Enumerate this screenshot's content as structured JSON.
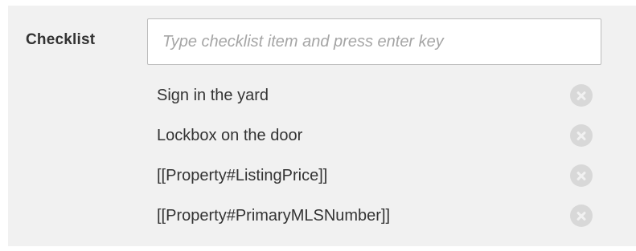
{
  "checklist": {
    "label": "Checklist",
    "input_placeholder": "Type checklist item and press enter key",
    "input_value": "",
    "items": [
      {
        "text": "Sign in the yard",
        "remove_icon": "close-circle-icon"
      },
      {
        "text": "Lockbox on the door",
        "remove_icon": "close-circle-icon"
      },
      {
        "text": "[[Property#ListingPrice]]",
        "remove_icon": "close-circle-icon"
      },
      {
        "text": "[[Property#PrimaryMLSNumber]]",
        "remove_icon": "close-circle-icon"
      }
    ]
  },
  "colors": {
    "panel_background": "#f1f1f1",
    "text": "#333333",
    "placeholder": "#a5a5a5",
    "remove_icon": "#d8d8d8"
  }
}
